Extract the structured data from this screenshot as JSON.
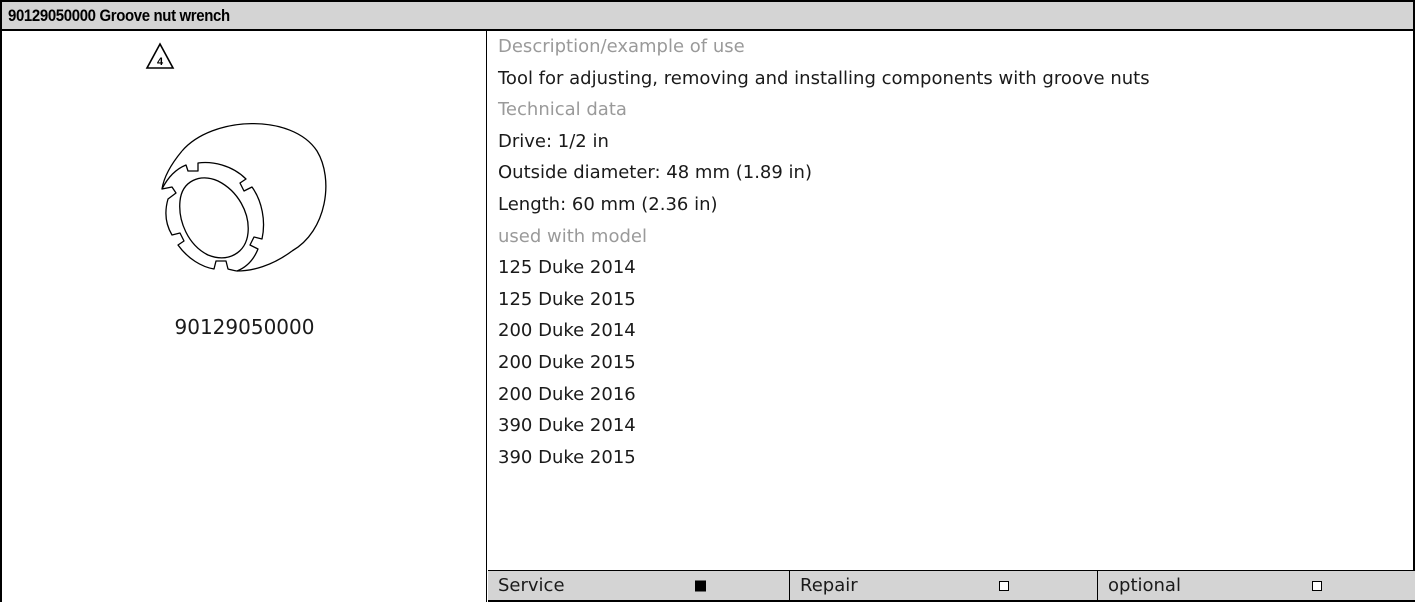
{
  "header": {
    "title": "90129050000 Groove nut wrench"
  },
  "figure": {
    "warning_number": "4",
    "part_number": "90129050000"
  },
  "details": {
    "description_heading": "Description/example of use",
    "description_text": "Tool for adjusting, removing and installing components with groove nuts",
    "technical_heading": "Technical data",
    "technical_lines": [
      "Drive: 1/2 in",
      "Outside diameter: 48 mm (1.89 in)",
      "Length: 60 mm (2.36 in)"
    ],
    "models_heading": "used with model",
    "models": [
      "125 Duke 2014",
      "125 Duke 2015",
      "200 Duke 2014",
      "200 Duke 2015",
      "200 Duke 2016",
      "390 Duke 2014",
      "390 Duke 2015"
    ]
  },
  "footer": {
    "categories": [
      {
        "label": "Service",
        "checked": true
      },
      {
        "label": "Repair",
        "checked": false
      },
      {
        "label": "optional",
        "checked": false
      }
    ]
  },
  "colors": {
    "title_background": "#d4d4d4",
    "heading_text": "#9a9a9a",
    "body_text": "#1a1a1a",
    "rule": "#000000"
  }
}
